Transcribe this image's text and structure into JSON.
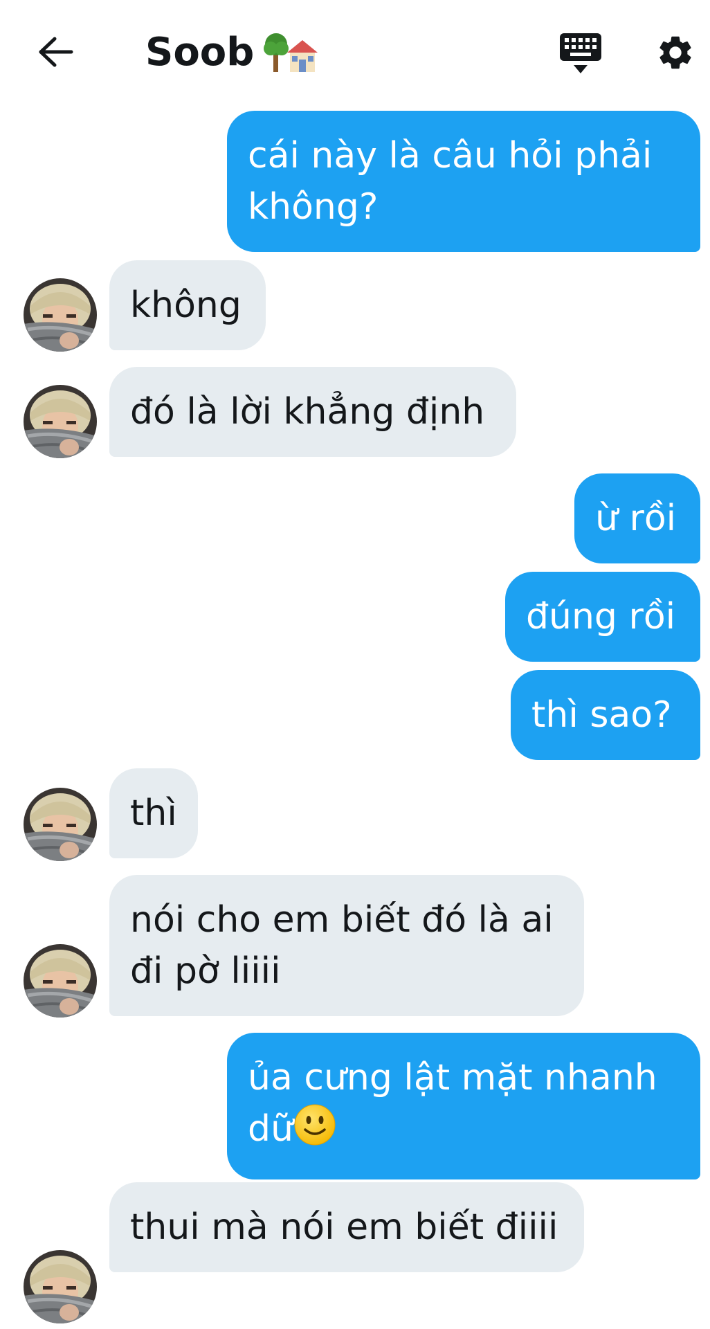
{
  "header": {
    "title": "Soob",
    "title_emoji": "🌳🏠",
    "icons": [
      "back-arrow-icon",
      "keyboard-icon",
      "gear-icon"
    ]
  },
  "conversation": [
    {
      "from": "me",
      "text": "cái này là câu hỏi phải không?"
    },
    {
      "from": "them",
      "text": "không"
    },
    {
      "from": "them",
      "text": "đó là lời khẳng định"
    },
    {
      "from": "me",
      "text": "ừ rồi"
    },
    {
      "from": "me",
      "text": "đúng rồi"
    },
    {
      "from": "me",
      "text": "thì sao?"
    },
    {
      "from": "them",
      "text": "thì"
    },
    {
      "from": "them",
      "text": "nói cho em biết đó là ai đi pờ liiii"
    },
    {
      "from": "me",
      "text": "ủa cưng lật mặt nhanh dữ",
      "emoji": "🙂"
    },
    {
      "from": "them",
      "text": "thui mà nói em biết điiii"
    }
  ],
  "colors": {
    "outgoing_bubble": "#1da1f2",
    "incoming_bubble": "#e6ecf0",
    "text_dark": "#14171a",
    "background": "#ffffff"
  }
}
